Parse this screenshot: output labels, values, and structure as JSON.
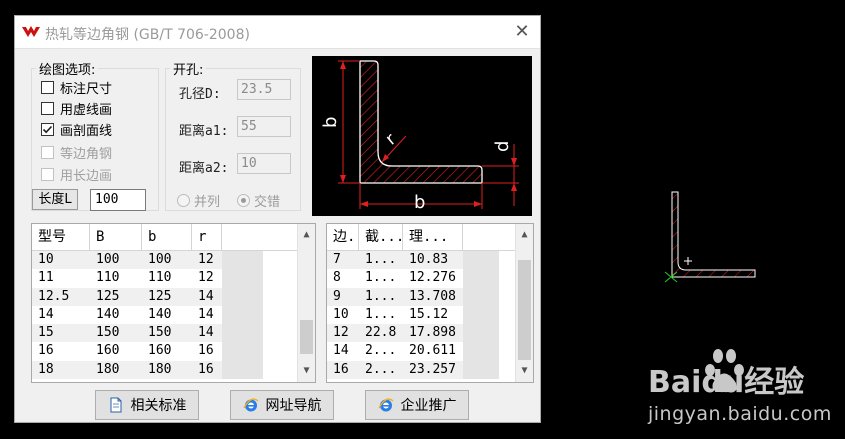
{
  "window": {
    "title": "热轧等边角钢 (GB/T 706-2008)",
    "close_glyph": "✕"
  },
  "draw_options": {
    "legend": "绘图选项:",
    "items": [
      {
        "label": "标注尺寸",
        "checked": false,
        "enabled": true
      },
      {
        "label": "用虚线画",
        "checked": false,
        "enabled": true
      },
      {
        "label": "画剖面线",
        "checked": true,
        "enabled": true
      },
      {
        "label": "等边角钢",
        "checked": false,
        "enabled": false
      },
      {
        "label": "用长边画",
        "checked": false,
        "enabled": false
      }
    ],
    "length_button": "长度L",
    "length_value": "100"
  },
  "hole": {
    "legend": "开孔:",
    "diameter_label": "孔径D:",
    "diameter_value": "23.5",
    "a1_label": "距离a1:",
    "a1_value": "55",
    "a2_label": "距离a2:",
    "a2_value": "10",
    "radio_parallel": "并列",
    "radio_stagger": "交错"
  },
  "diagram_labels": {
    "b_left": "b",
    "r": "r",
    "d": "d",
    "b_bottom": "b"
  },
  "table_left": {
    "headers": [
      "型号",
      "B",
      "b",
      "r"
    ],
    "rows": [
      [
        "10",
        "100",
        "100",
        "12"
      ],
      [
        "11",
        "110",
        "110",
        "12"
      ],
      [
        "12.5",
        "125",
        "125",
        "14"
      ],
      [
        "14",
        "140",
        "140",
        "14"
      ],
      [
        "15",
        "150",
        "150",
        "14"
      ],
      [
        "16",
        "160",
        "160",
        "16"
      ],
      [
        "18",
        "180",
        "180",
        "16"
      ]
    ]
  },
  "table_right": {
    "headers": [
      "边.",
      "截...",
      "理..."
    ],
    "rows": [
      [
        "7",
        "1...",
        "10.83"
      ],
      [
        "8",
        "1...",
        "12.276"
      ],
      [
        "9",
        "1...",
        "13.708"
      ],
      [
        "10",
        "1...",
        "15.12"
      ],
      [
        "12",
        "22.8",
        "17.898"
      ],
      [
        "14",
        "2...",
        "20.611"
      ],
      [
        "16",
        "2...",
        "23.257"
      ]
    ]
  },
  "buttons": {
    "standards": "相关标准",
    "web_nav": "网址导航",
    "enterprise": "企业推广"
  },
  "watermark": {
    "brand": "Baidu经验",
    "url": "jingyan.baidu.com"
  },
  "colors": {
    "accent_red": "#e02020",
    "white": "#ffffff",
    "cad_green": "#22cc22"
  }
}
